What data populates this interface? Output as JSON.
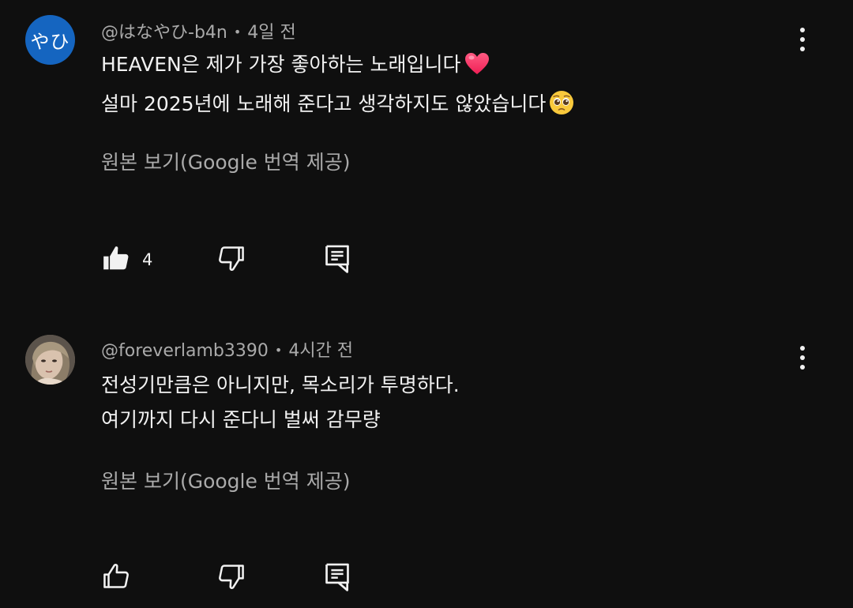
{
  "comments": [
    {
      "avatar_text": "やひ",
      "avatar_color": "#1565c0",
      "author": "@はなやひ-b4n",
      "separator": "•",
      "time": "4일 전",
      "lines": [
        "HEAVEN은 제가 가장 좋아하는 노래입니다",
        "설마 2025년에 노래해 준다고 생각하지도 않았습니다"
      ],
      "line_emojis": [
        "red-heart-emoji",
        "pleading-face-emoji"
      ],
      "translate_label": "원본 보기(Google 번역 제공)",
      "like_count": "4",
      "liked": true
    },
    {
      "avatar_text": "",
      "author": "@foreverlamb3390",
      "separator": "•",
      "time": "4시간 전",
      "lines": [
        "전성기만큼은 아니지만, 목소리가 투명하다.",
        "여기까지 다시 준다니 벌써 감무량"
      ],
      "translate_label": "원본 보기(Google 번역 제공)",
      "like_count": "",
      "liked": false
    }
  ],
  "icons": {
    "like": "thumbs-up-icon",
    "dislike": "thumbs-down-icon",
    "reply": "reply-comment-icon",
    "menu": "more-vertical-icon"
  },
  "colors": {
    "background": "#0f0f0f",
    "text_primary": "#f1f1f1",
    "text_secondary": "#aaaaaa"
  }
}
